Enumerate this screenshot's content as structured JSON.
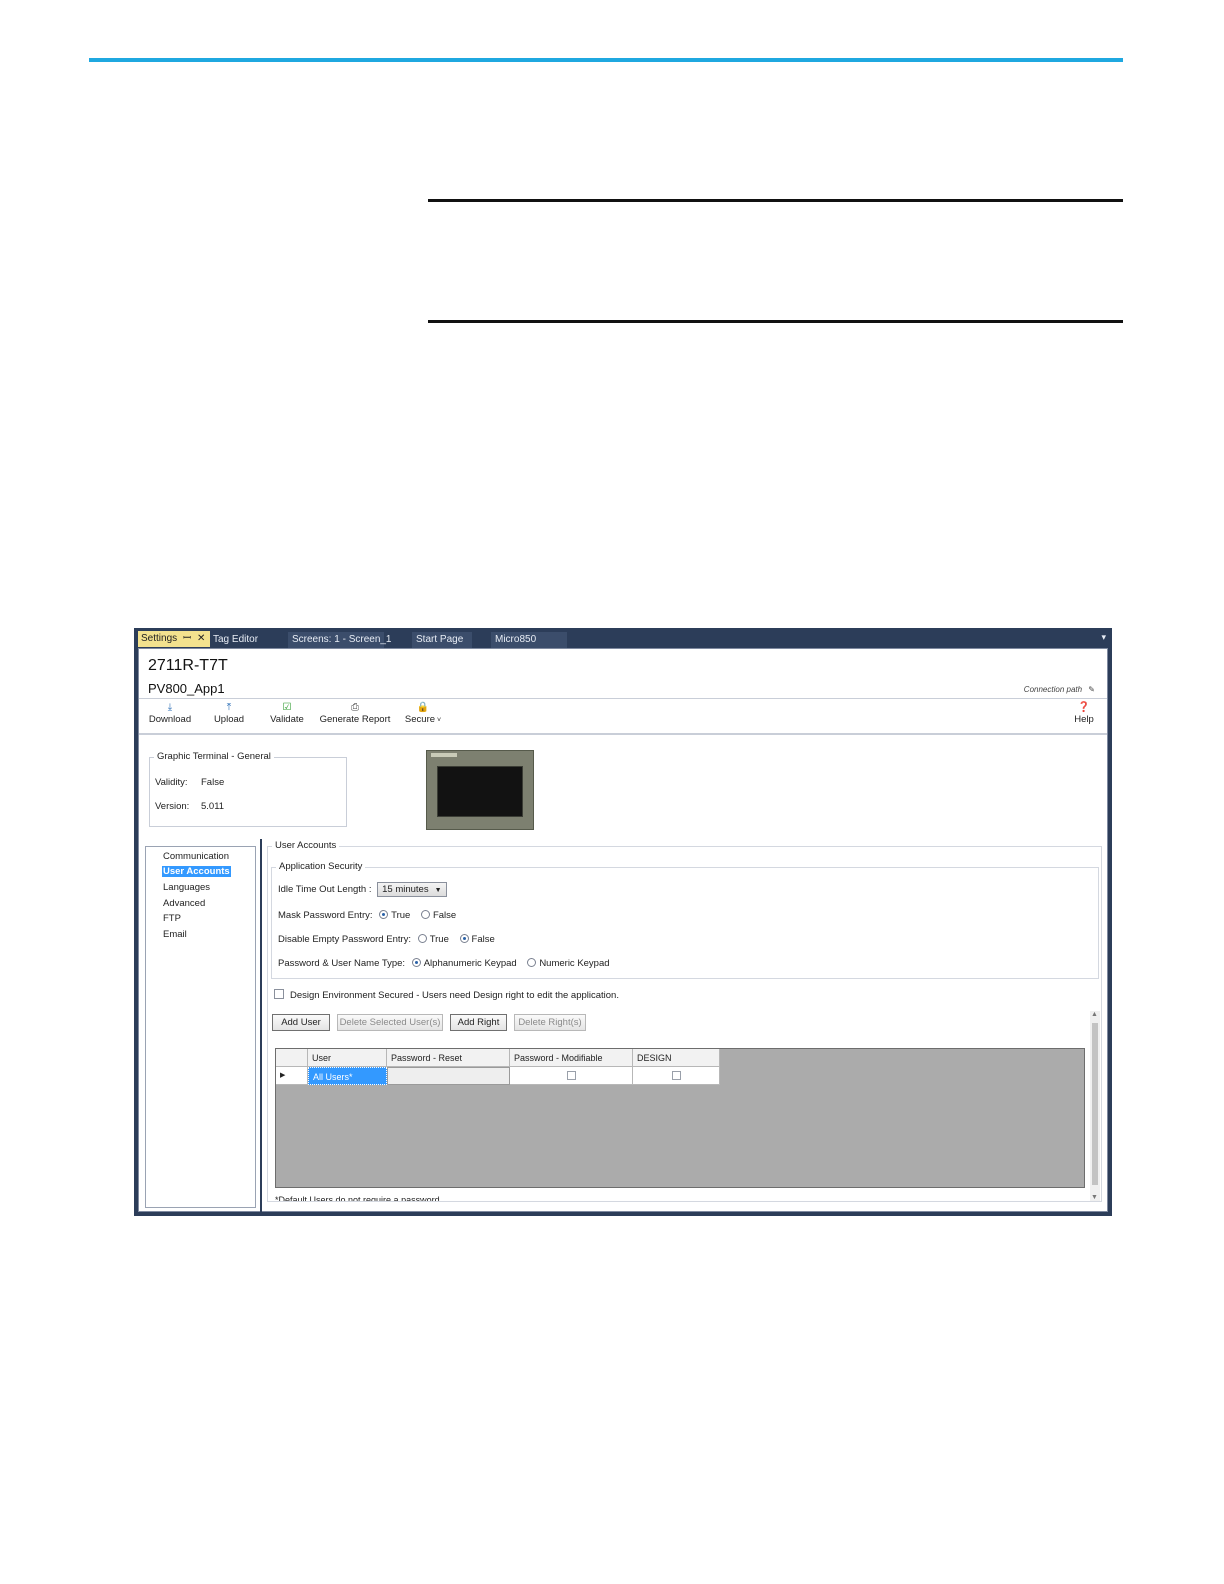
{
  "tabs": {
    "settings": "Settings",
    "settings_pin": "ꟷ",
    "settings_close": "✕",
    "tag_editor": "Tag Editor",
    "screens": "Screens: 1 - Screen_1",
    "start_page": "Start Page",
    "micro850": "Micro850",
    "dropdown": "▾"
  },
  "header": {
    "model": "2711R-T7T",
    "app_name": "PV800_App1",
    "connection_path": "Connection path"
  },
  "toolbar": {
    "download": "Download",
    "upload": "Upload",
    "validate": "Validate",
    "generate_report": "Generate Report",
    "secure": "Secure",
    "help": "Help"
  },
  "general": {
    "legend": "Graphic Terminal - General",
    "validity_label": "Validity:",
    "validity_value": "False",
    "version_label": "Version:",
    "version_value": "5.011"
  },
  "nav": {
    "items": [
      "Communication",
      "User Accounts",
      "Languages",
      "Advanced",
      "FTP",
      "Email"
    ],
    "selected": "User Accounts"
  },
  "user_accounts": {
    "legend": "User Accounts",
    "app_security_legend": "Application Security",
    "idle_label": "Idle Time Out Length :",
    "idle_value": "15 minutes",
    "mask_label": "Mask Password Entry:",
    "mask_true": "True",
    "mask_false": "False",
    "mask_selected": "True",
    "empty_label": "Disable Empty Password Entry:",
    "empty_true": "True",
    "empty_false": "False",
    "empty_selected": "False",
    "type_label": "Password & User Name Type:",
    "type_alpha": "Alphanumeric Keypad",
    "type_numeric": "Numeric Keypad",
    "type_selected": "Alphanumeric Keypad",
    "design_secured": "Design Environment Secured - Users need Design right to edit the application.",
    "design_secured_checked": false
  },
  "buttons": {
    "add_user": "Add User",
    "delete_users": "Delete Selected User(s)",
    "add_right": "Add Right",
    "delete_rights": "Delete Right(s)"
  },
  "grid": {
    "columns": [
      "User",
      "Password - Reset",
      "Password - Modifiable",
      "DESIGN"
    ],
    "rows": [
      {
        "user": "All Users*",
        "password_reset": "",
        "password_modifiable": false,
        "design": false
      }
    ],
    "row_indicator": "▶"
  },
  "footnote": "*Default Users do not require a password"
}
